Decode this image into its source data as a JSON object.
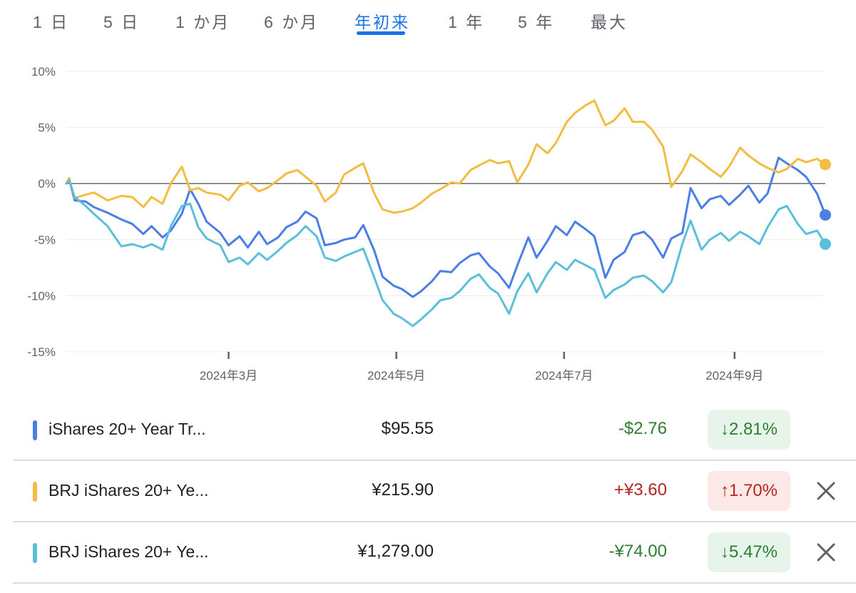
{
  "tabs": [
    {
      "label": "1 日",
      "active": false
    },
    {
      "label": "5 日",
      "active": false
    },
    {
      "label": "1 か月",
      "active": false
    },
    {
      "label": "6 か月",
      "active": false
    },
    {
      "label": "年初来",
      "active": true
    },
    {
      "label": "1 年",
      "active": false
    },
    {
      "label": "5 年",
      "active": false
    },
    {
      "label": "最大",
      "active": false
    }
  ],
  "colors": {
    "blue": "#4a7fe6",
    "yellow": "#f2bd42",
    "cyan": "#5bbfdb",
    "negative": "#2e7d32",
    "negative_bg": "#e6f4ea",
    "positive": "#b3261e",
    "positive_bg": "#fce8e6"
  },
  "chart_data": {
    "type": "line",
    "ylim": [
      -15,
      10
    ],
    "yticks": [
      "10%",
      "5%",
      "0%",
      "-5%",
      "-10%",
      "-15%"
    ],
    "xticks": [
      "2024年3月",
      "2024年5月",
      "2024年7月",
      "2024年9月"
    ],
    "xlim": [
      "2024-01-02",
      "2024-10-04"
    ],
    "series": [
      {
        "color": "blue",
        "points": [
          [
            "2024-01-02",
            0
          ],
          [
            "2024-01-03",
            0.4
          ],
          [
            "2024-01-05",
            -1.5
          ],
          [
            "2024-01-09",
            -1.6
          ],
          [
            "2024-01-12",
            -2.1
          ],
          [
            "2024-01-17",
            -2.6
          ],
          [
            "2024-01-22",
            -3.2
          ],
          [
            "2024-01-26",
            -3.6
          ],
          [
            "2024-01-30",
            -4.5
          ],
          [
            "2024-02-02",
            -3.8
          ],
          [
            "2024-02-06",
            -4.8
          ],
          [
            "2024-02-09",
            -4.2
          ],
          [
            "2024-02-13",
            -2.7
          ],
          [
            "2024-02-16",
            -0.5
          ],
          [
            "2024-02-19",
            -1.8
          ],
          [
            "2024-02-22",
            -3.4
          ],
          [
            "2024-02-27",
            -4.4
          ],
          [
            "2024-03-01",
            -5.5
          ],
          [
            "2024-03-05",
            -4.7
          ],
          [
            "2024-03-08",
            -5.7
          ],
          [
            "2024-03-12",
            -4.3
          ],
          [
            "2024-03-15",
            -5.4
          ],
          [
            "2024-03-19",
            -4.8
          ],
          [
            "2024-03-22",
            -3.9
          ],
          [
            "2024-03-26",
            -3.4
          ],
          [
            "2024-03-29",
            -2.5
          ],
          [
            "2024-04-02",
            -3.1
          ],
          [
            "2024-04-05",
            -5.5
          ],
          [
            "2024-04-09",
            -5.3
          ],
          [
            "2024-04-12",
            -5.0
          ],
          [
            "2024-04-16",
            -4.8
          ],
          [
            "2024-04-19",
            -3.7
          ],
          [
            "2024-04-23",
            -6.0
          ],
          [
            "2024-04-26",
            -8.3
          ],
          [
            "2024-04-30",
            -9.1
          ],
          [
            "2024-05-03",
            -9.4
          ],
          [
            "2024-05-07",
            -10.1
          ],
          [
            "2024-05-10",
            -9.6
          ],
          [
            "2024-05-14",
            -8.7
          ],
          [
            "2024-05-17",
            -7.8
          ],
          [
            "2024-05-21",
            -7.9
          ],
          [
            "2024-05-24",
            -7.1
          ],
          [
            "2024-05-28",
            -6.4
          ],
          [
            "2024-05-31",
            -6.2
          ],
          [
            "2024-06-04",
            -7.4
          ],
          [
            "2024-06-07",
            -8.0
          ],
          [
            "2024-06-11",
            -9.3
          ],
          [
            "2024-06-14",
            -7.3
          ],
          [
            "2024-06-18",
            -4.8
          ],
          [
            "2024-06-21",
            -6.6
          ],
          [
            "2024-06-25",
            -5.1
          ],
          [
            "2024-06-28",
            -3.8
          ],
          [
            "2024-07-02",
            -4.6
          ],
          [
            "2024-07-05",
            -3.4
          ],
          [
            "2024-07-09",
            -4.1
          ],
          [
            "2024-07-12",
            -4.7
          ],
          [
            "2024-07-16",
            -8.4
          ],
          [
            "2024-07-19",
            -6.8
          ],
          [
            "2024-07-23",
            -6.1
          ],
          [
            "2024-07-26",
            -4.6
          ],
          [
            "2024-07-30",
            -4.3
          ],
          [
            "2024-08-02",
            -5.0
          ],
          [
            "2024-08-06",
            -6.6
          ],
          [
            "2024-08-09",
            -4.9
          ],
          [
            "2024-08-13",
            -4.4
          ],
          [
            "2024-08-16",
            -0.4
          ],
          [
            "2024-08-20",
            -2.2
          ],
          [
            "2024-08-23",
            -1.4
          ],
          [
            "2024-08-27",
            -1.1
          ],
          [
            "2024-08-30",
            -1.9
          ],
          [
            "2024-09-03",
            -1.0
          ],
          [
            "2024-09-06",
            -0.2
          ],
          [
            "2024-09-10",
            -1.7
          ],
          [
            "2024-09-13",
            -0.9
          ],
          [
            "2024-09-17",
            2.3
          ],
          [
            "2024-09-20",
            1.8
          ],
          [
            "2024-09-24",
            1.2
          ],
          [
            "2024-09-27",
            0.6
          ],
          [
            "2024-10-01",
            -0.9
          ],
          [
            "2024-10-04",
            -2.8
          ]
        ]
      },
      {
        "color": "yellow",
        "points": [
          [
            "2024-01-02",
            0
          ],
          [
            "2024-01-03",
            0.5
          ],
          [
            "2024-01-05",
            -1.3
          ],
          [
            "2024-01-09",
            -1.0
          ],
          [
            "2024-01-12",
            -0.8
          ],
          [
            "2024-01-17",
            -1.5
          ],
          [
            "2024-01-22",
            -1.1
          ],
          [
            "2024-01-26",
            -1.2
          ],
          [
            "2024-01-30",
            -2.1
          ],
          [
            "2024-02-02",
            -1.2
          ],
          [
            "2024-02-06",
            -1.8
          ],
          [
            "2024-02-09",
            0.0
          ],
          [
            "2024-02-13",
            1.5
          ],
          [
            "2024-02-16",
            -0.6
          ],
          [
            "2024-02-19",
            -0.4
          ],
          [
            "2024-02-22",
            -0.8
          ],
          [
            "2024-02-27",
            -1.0
          ],
          [
            "2024-03-01",
            -1.5
          ],
          [
            "2024-03-05",
            -0.2
          ],
          [
            "2024-03-08",
            0.1
          ],
          [
            "2024-03-12",
            -0.7
          ],
          [
            "2024-03-15",
            -0.4
          ],
          [
            "2024-03-19",
            0.3
          ],
          [
            "2024-03-22",
            0.9
          ],
          [
            "2024-03-26",
            1.2
          ],
          [
            "2024-03-29",
            0.6
          ],
          [
            "2024-04-02",
            -0.2
          ],
          [
            "2024-04-05",
            -1.6
          ],
          [
            "2024-04-09",
            -0.8
          ],
          [
            "2024-04-12",
            0.8
          ],
          [
            "2024-04-16",
            1.4
          ],
          [
            "2024-04-19",
            1.8
          ],
          [
            "2024-04-23",
            -0.9
          ],
          [
            "2024-04-26",
            -2.3
          ],
          [
            "2024-04-30",
            -2.6
          ],
          [
            "2024-05-03",
            -2.5
          ],
          [
            "2024-05-07",
            -2.2
          ],
          [
            "2024-05-10",
            -1.7
          ],
          [
            "2024-05-14",
            -0.9
          ],
          [
            "2024-05-17",
            -0.5
          ],
          [
            "2024-05-21",
            0.1
          ],
          [
            "2024-05-24",
            0.0
          ],
          [
            "2024-05-28",
            1.2
          ],
          [
            "2024-05-31",
            1.6
          ],
          [
            "2024-06-04",
            2.1
          ],
          [
            "2024-06-07",
            1.8
          ],
          [
            "2024-06-11",
            2.0
          ],
          [
            "2024-06-14",
            0.1
          ],
          [
            "2024-06-18",
            1.7
          ],
          [
            "2024-06-21",
            3.5
          ],
          [
            "2024-06-25",
            2.7
          ],
          [
            "2024-06-28",
            3.6
          ],
          [
            "2024-07-02",
            5.5
          ],
          [
            "2024-07-05",
            6.3
          ],
          [
            "2024-07-09",
            7.0
          ],
          [
            "2024-07-12",
            7.4
          ],
          [
            "2024-07-16",
            5.2
          ],
          [
            "2024-07-19",
            5.6
          ],
          [
            "2024-07-23",
            6.7
          ],
          [
            "2024-07-26",
            5.5
          ],
          [
            "2024-07-30",
            5.5
          ],
          [
            "2024-08-02",
            4.8
          ],
          [
            "2024-08-06",
            3.3
          ],
          [
            "2024-08-09",
            -0.3
          ],
          [
            "2024-08-13",
            1.1
          ],
          [
            "2024-08-16",
            2.6
          ],
          [
            "2024-08-20",
            1.9
          ],
          [
            "2024-08-23",
            1.3
          ],
          [
            "2024-08-27",
            0.6
          ],
          [
            "2024-08-30",
            1.5
          ],
          [
            "2024-09-03",
            3.2
          ],
          [
            "2024-09-06",
            2.5
          ],
          [
            "2024-09-10",
            1.8
          ],
          [
            "2024-09-13",
            1.4
          ],
          [
            "2024-09-17",
            1.0
          ],
          [
            "2024-09-20",
            1.3
          ],
          [
            "2024-09-24",
            2.2
          ],
          [
            "2024-09-27",
            1.9
          ],
          [
            "2024-10-01",
            2.2
          ],
          [
            "2024-10-04",
            1.7
          ]
        ]
      },
      {
        "color": "cyan",
        "points": [
          [
            "2024-01-02",
            0
          ],
          [
            "2024-01-03",
            0.3
          ],
          [
            "2024-01-05",
            -1.2
          ],
          [
            "2024-01-09",
            -2.0
          ],
          [
            "2024-01-12",
            -2.7
          ],
          [
            "2024-01-17",
            -3.8
          ],
          [
            "2024-01-22",
            -5.6
          ],
          [
            "2024-01-26",
            -5.4
          ],
          [
            "2024-01-30",
            -5.7
          ],
          [
            "2024-02-02",
            -5.4
          ],
          [
            "2024-02-06",
            -5.9
          ],
          [
            "2024-02-09",
            -3.8
          ],
          [
            "2024-02-13",
            -2.0
          ],
          [
            "2024-02-16",
            -1.8
          ],
          [
            "2024-02-19",
            -3.9
          ],
          [
            "2024-02-22",
            -4.9
          ],
          [
            "2024-02-27",
            -5.5
          ],
          [
            "2024-03-01",
            -7.0
          ],
          [
            "2024-03-05",
            -6.6
          ],
          [
            "2024-03-08",
            -7.2
          ],
          [
            "2024-03-12",
            -6.2
          ],
          [
            "2024-03-15",
            -6.8
          ],
          [
            "2024-03-19",
            -6.0
          ],
          [
            "2024-03-22",
            -5.3
          ],
          [
            "2024-03-26",
            -4.6
          ],
          [
            "2024-03-29",
            -3.8
          ],
          [
            "2024-04-02",
            -4.7
          ],
          [
            "2024-04-05",
            -6.6
          ],
          [
            "2024-04-09",
            -6.9
          ],
          [
            "2024-04-12",
            -6.5
          ],
          [
            "2024-04-16",
            -6.1
          ],
          [
            "2024-04-19",
            -5.8
          ],
          [
            "2024-04-23",
            -8.4
          ],
          [
            "2024-04-26",
            -10.4
          ],
          [
            "2024-04-30",
            -11.6
          ],
          [
            "2024-05-03",
            -12.0
          ],
          [
            "2024-05-07",
            -12.7
          ],
          [
            "2024-05-10",
            -12.1
          ],
          [
            "2024-05-14",
            -11.2
          ],
          [
            "2024-05-17",
            -10.4
          ],
          [
            "2024-05-21",
            -10.2
          ],
          [
            "2024-05-24",
            -9.6
          ],
          [
            "2024-05-28",
            -8.5
          ],
          [
            "2024-05-31",
            -8.1
          ],
          [
            "2024-06-04",
            -9.3
          ],
          [
            "2024-06-07",
            -9.8
          ],
          [
            "2024-06-11",
            -11.6
          ],
          [
            "2024-06-14",
            -9.6
          ],
          [
            "2024-06-18",
            -8.0
          ],
          [
            "2024-06-21",
            -9.7
          ],
          [
            "2024-06-25",
            -8.0
          ],
          [
            "2024-06-28",
            -7.0
          ],
          [
            "2024-07-02",
            -7.7
          ],
          [
            "2024-07-05",
            -6.8
          ],
          [
            "2024-07-09",
            -7.3
          ],
          [
            "2024-07-12",
            -7.7
          ],
          [
            "2024-07-16",
            -10.2
          ],
          [
            "2024-07-19",
            -9.5
          ],
          [
            "2024-07-23",
            -9.0
          ],
          [
            "2024-07-26",
            -8.4
          ],
          [
            "2024-07-30",
            -8.2
          ],
          [
            "2024-08-02",
            -8.7
          ],
          [
            "2024-08-06",
            -9.7
          ],
          [
            "2024-08-09",
            -8.8
          ],
          [
            "2024-08-13",
            -5.4
          ],
          [
            "2024-08-16",
            -3.3
          ],
          [
            "2024-08-20",
            -5.9
          ],
          [
            "2024-08-23",
            -5.0
          ],
          [
            "2024-08-27",
            -4.4
          ],
          [
            "2024-08-30",
            -5.1
          ],
          [
            "2024-09-03",
            -4.3
          ],
          [
            "2024-09-06",
            -4.7
          ],
          [
            "2024-09-10",
            -5.4
          ],
          [
            "2024-09-13",
            -3.9
          ],
          [
            "2024-09-17",
            -2.3
          ],
          [
            "2024-09-20",
            -2.0
          ],
          [
            "2024-09-24",
            -3.6
          ],
          [
            "2024-09-27",
            -4.5
          ],
          [
            "2024-10-01",
            -4.2
          ],
          [
            "2024-10-04",
            -5.4
          ]
        ]
      }
    ]
  },
  "rows": [
    {
      "color": "blue",
      "name": "iShares 20+ Year Tr...",
      "price": "$95.55",
      "change": "-$2.76",
      "change_type": "negative",
      "badge": "↓2.81%",
      "closable": false
    },
    {
      "color": "yellow",
      "name": "BRJ iShares 20+ Ye...",
      "price": "¥215.90",
      "change": "+¥3.60",
      "change_type": "positive",
      "badge": "↑1.70%",
      "closable": true
    },
    {
      "color": "cyan",
      "name": "BRJ iShares 20+ Ye...",
      "price": "¥1,279.00",
      "change": "-¥74.00",
      "change_type": "negative",
      "badge": "↓5.47%",
      "closable": true
    }
  ]
}
